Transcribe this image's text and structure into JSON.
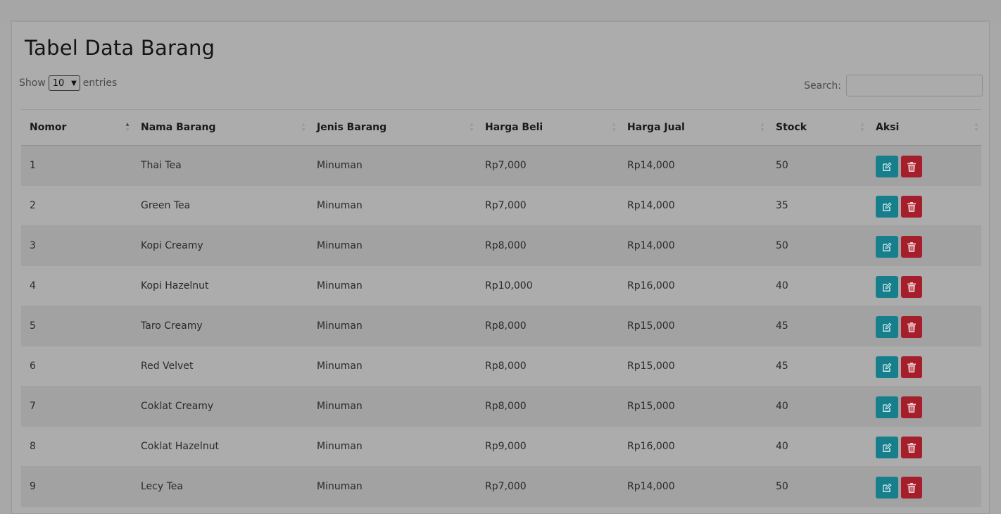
{
  "page": {
    "title": "Tabel Data Barang"
  },
  "length": {
    "show_label": "Show",
    "selected": "10",
    "entries_label": "entries"
  },
  "search": {
    "label": "Search:",
    "value": ""
  },
  "table": {
    "headers": [
      "Nomor",
      "Nama Barang",
      "Jenis Barang",
      "Harga Beli",
      "Harga Jual",
      "Stock",
      "Aksi"
    ],
    "rows": [
      {
        "no": "1",
        "nama": "Thai Tea",
        "jenis": "Minuman",
        "beli": "Rp7,000",
        "jual": "Rp14,000",
        "stock": "50"
      },
      {
        "no": "2",
        "nama": "Green Tea",
        "jenis": "Minuman",
        "beli": "Rp7,000",
        "jual": "Rp14,000",
        "stock": "35"
      },
      {
        "no": "3",
        "nama": "Kopi Creamy",
        "jenis": "Minuman",
        "beli": "Rp8,000",
        "jual": "Rp14,000",
        "stock": "50"
      },
      {
        "no": "4",
        "nama": "Kopi Hazelnut",
        "jenis": "Minuman",
        "beli": "Rp10,000",
        "jual": "Rp16,000",
        "stock": "40"
      },
      {
        "no": "5",
        "nama": "Taro Creamy",
        "jenis": "Minuman",
        "beli": "Rp8,000",
        "jual": "Rp15,000",
        "stock": "45"
      },
      {
        "no": "6",
        "nama": "Red Velvet",
        "jenis": "Minuman",
        "beli": "Rp8,000",
        "jual": "Rp15,000",
        "stock": "45"
      },
      {
        "no": "7",
        "nama": "Coklat Creamy",
        "jenis": "Minuman",
        "beli": "Rp8,000",
        "jual": "Rp15,000",
        "stock": "40"
      },
      {
        "no": "8",
        "nama": "Coklat Hazelnut",
        "jenis": "Minuman",
        "beli": "Rp9,000",
        "jual": "Rp16,000",
        "stock": "40"
      },
      {
        "no": "9",
        "nama": "Lecy Tea",
        "jenis": "Minuman",
        "beli": "Rp7,000",
        "jual": "Rp14,000",
        "stock": "50"
      }
    ],
    "actions": {
      "edit_icon": "edit-icon",
      "delete_icon": "trash-icon"
    }
  },
  "colors": {
    "edit_button": "#177f8c",
    "delete_button": "#a41e2c"
  }
}
